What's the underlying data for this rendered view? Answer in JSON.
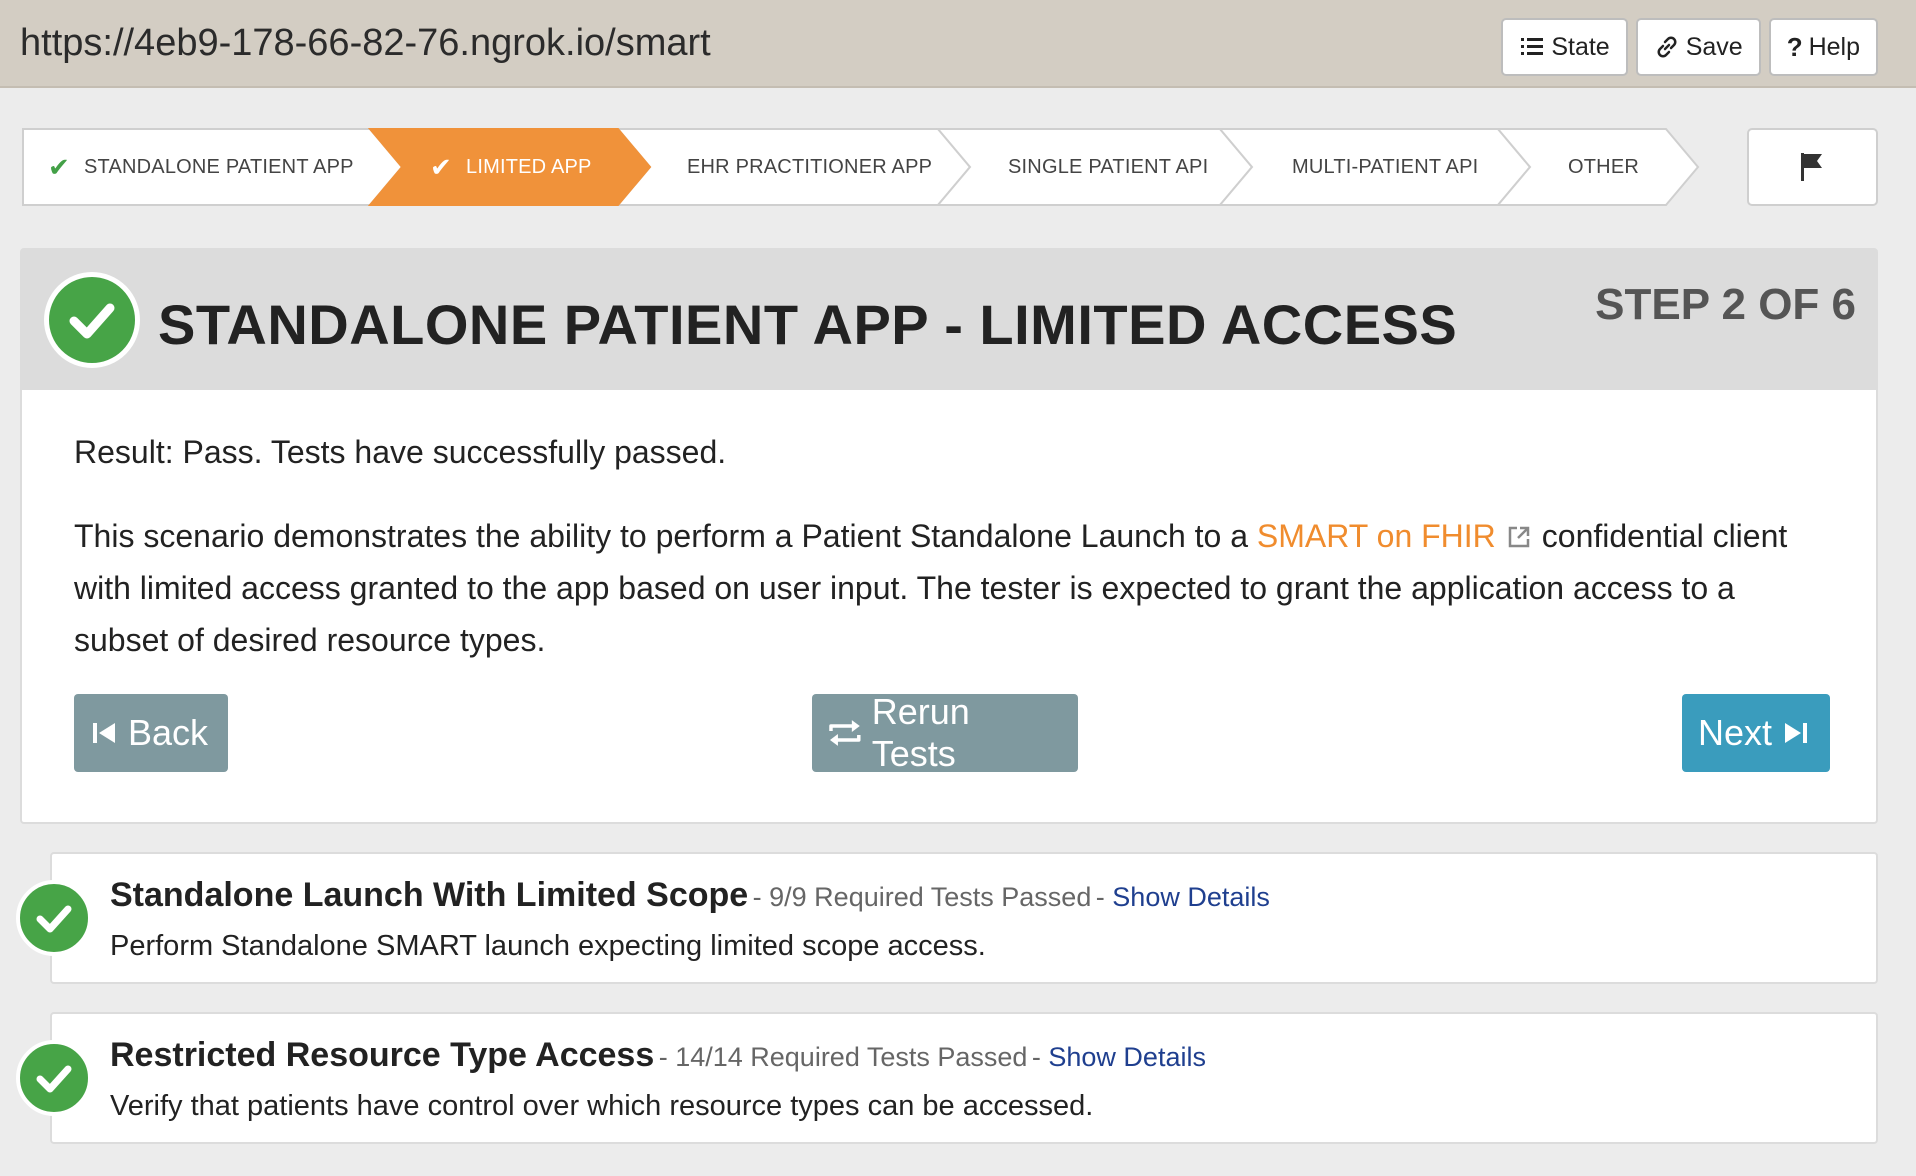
{
  "header": {
    "url": "https://4eb9-178-66-82-76.ngrok.io/smart",
    "buttons": {
      "state": "State",
      "save": "Save",
      "help": "Help"
    }
  },
  "stepper": {
    "steps": [
      {
        "label": "STANDALONE PATIENT APP",
        "status": "passed",
        "active": false
      },
      {
        "label": "LIMITED APP",
        "status": "passed",
        "active": true
      },
      {
        "label": "EHR PRACTITIONER APP",
        "status": "none",
        "active": false
      },
      {
        "label": "SINGLE PATIENT API",
        "status": "none",
        "active": false
      },
      {
        "label": "MULTI-PATIENT API",
        "status": "none",
        "active": false
      },
      {
        "label": "OTHER",
        "status": "none",
        "active": false
      }
    ],
    "flag_icon": "flag-icon"
  },
  "panel": {
    "title": "STANDALONE PATIENT APP - LIMITED ACCESS",
    "step": "STEP 2 OF 6",
    "result": "Result: Pass. Tests have successfully passed.",
    "desc_before": "This scenario demonstrates the ability to perform a Patient Standalone Launch to a",
    "desc_link": "SMART on FHIR",
    "desc_after": "confidential client with limited access granted to the app based on user input. The tester is expected to grant the application access to a subset of desired resource types.",
    "buttons": {
      "back": "Back",
      "rerun": "Rerun Tests",
      "next": "Next"
    }
  },
  "tests": [
    {
      "title": "Standalone Launch With Limited Scope",
      "summary": "9/9 Required Tests Passed",
      "link": "Show Details",
      "description": "Perform Standalone SMART launch expecting limited scope access."
    },
    {
      "title": "Restricted Resource Type Access",
      "summary": "14/14 Required Tests Passed",
      "link": "Show Details",
      "description": "Verify that patients have control over which resource types can be accessed."
    }
  ],
  "colors": {
    "active_step": "#f0923a",
    "pass_green": "#47a447",
    "next_button": "#3a9cbd",
    "secondary_button": "#7f999f",
    "link_orange": "#f08c2e",
    "link_blue": "#1f3f8f"
  }
}
